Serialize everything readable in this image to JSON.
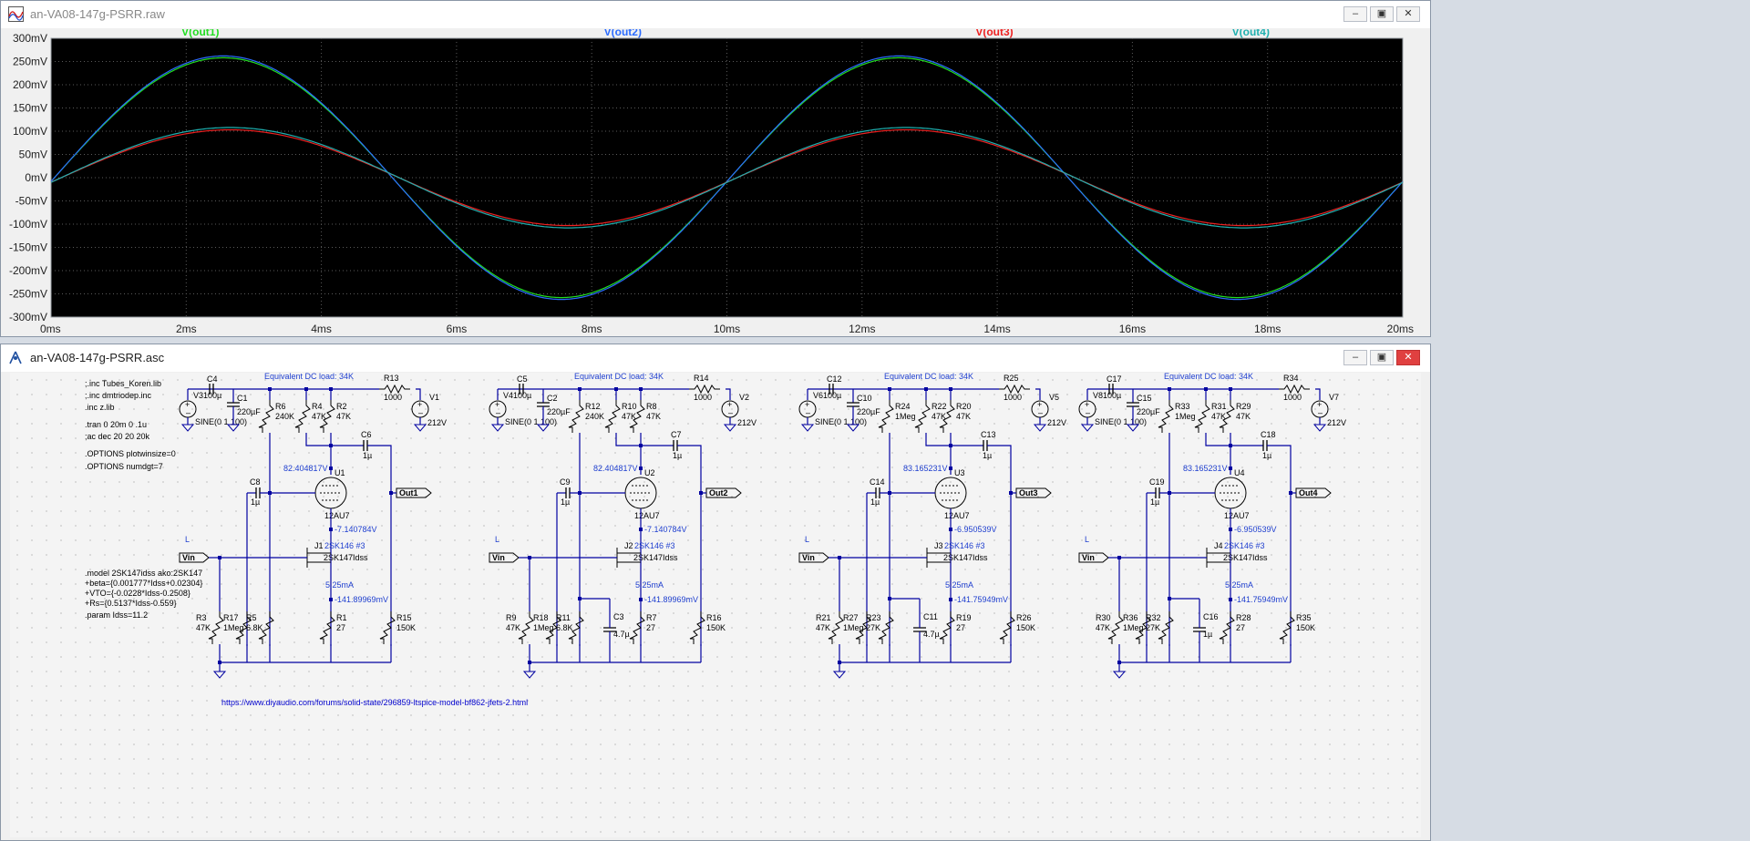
{
  "waveform_window": {
    "title": "an-VA08-147g-PSRR.raw",
    "traces": [
      {
        "label": "V(out1)",
        "color": "#22dd22"
      },
      {
        "label": "V(out2)",
        "color": "#2b6cff"
      },
      {
        "label": "V(out3)",
        "color": "#ee2222"
      },
      {
        "label": "V(out4)",
        "color": "#20b0b0"
      }
    ],
    "y_ticks": [
      "300mV",
      "250mV",
      "200mV",
      "150mV",
      "100mV",
      "50mV",
      "0mV",
      "-50mV",
      "-100mV",
      "-150mV",
      "-200mV",
      "-250mV",
      "-300mV"
    ],
    "x_ticks": [
      "0ms",
      "2ms",
      "4ms",
      "6ms",
      "8ms",
      "10ms",
      "12ms",
      "14ms",
      "16ms",
      "18ms",
      "20ms"
    ]
  },
  "chart_data": {
    "type": "line",
    "xlabel": "",
    "ylabel": "",
    "xlim": [
      0,
      20
    ],
    "ylim": [
      -300,
      300
    ],
    "x_unit": "ms",
    "y_unit": "mV",
    "grid": true,
    "legend": "top",
    "series": [
      {
        "name": "V(out1)",
        "color": "#22dd22",
        "amplitude_mV": 258,
        "offset_mV": 0,
        "period_ms": 10,
        "phase_ms": 0.05
      },
      {
        "name": "V(out2)",
        "color": "#2b6cff",
        "amplitude_mV": 262,
        "offset_mV": 0,
        "period_ms": 10,
        "phase_ms": 0.05
      },
      {
        "name": "V(out3)",
        "color": "#ee2222",
        "amplitude_mV": 103,
        "offset_mV": 0,
        "period_ms": 10,
        "phase_ms": 0.15
      },
      {
        "name": "V(out4)",
        "color": "#20b0b0",
        "amplitude_mV": 108,
        "offset_mV": 0,
        "period_ms": 10,
        "phase_ms": 0.15
      }
    ]
  },
  "schematic_window": {
    "title": "an-VA08-147g-PSRR.asc",
    "directives": [
      ";.inc Tubes_Koren.lib",
      ";.inc dmtriodep.inc",
      ".inc z.lib",
      ".tran 0 20m 0 .1u",
      ";ac dec 20 20 20k",
      ".OPTIONS plotwinsize=0",
      ".OPTIONS numdgt=7"
    ],
    "model_lines": [
      ".model 2SK147idss ako:2SK147",
      "+beta={0.001777*Idss+0.02304}",
      "+VTO={-0.0228*Idss-0.2508}",
      "+Rs={0.5137*Idss-0.559}",
      ".param Idss=11.2"
    ],
    "url": "https://www.diyaudio.com/forums/solid-state/296859-ltspice-model-bf862-jfets-2.html",
    "cells": [
      {
        "header": "Equivalent DC load: 34K",
        "c_in": "C4",
        "c_in_val": "100µ",
        "vsrc": "V3",
        "vsrc_val": "SINE(0 1 100)",
        "c_bulk": "C1",
        "c_bulk_val": "220µF",
        "r_a": "R6",
        "r_a_val": "240K",
        "r_b": "R4",
        "r_b_val": "47K",
        "r_plate": "R2",
        "r_plate_val": "47K",
        "r_series": "R13",
        "r_series_val": "1000",
        "vdc": "V1",
        "vdc_val": "212V",
        "c_out": "C6",
        "c_out_val": "1µ",
        "vplate": "82.404817V",
        "tube": "U1",
        "tube_model": "12AU7",
        "c_grid": "C8",
        "c_grid_val": "1µ",
        "out_label": "Out1",
        "vgrid": "7.140784V",
        "jfet": "J1",
        "jfet_model": "2SK147Idss",
        "jfet_note": "2SK146 #3",
        "current": "5.25mA",
        "vsource": "141.89969mV",
        "r_bot1": "R3",
        "r_bot1_val": "47K",
        "r_bot2": "R17",
        "r_bot2_val": "1Meg",
        "r_bot3": "R5",
        "r_bot3_val": "6.8K",
        "r_cath": "R1",
        "r_cath_val": "27",
        "r_load": "R15",
        "r_load_val": "150K",
        "extra_c": "",
        "extra_c_val": "",
        "l_label": "L",
        "vin_label": "Vin"
      },
      {
        "header": "Equivalent DC load: 34K",
        "c_in": "C5",
        "c_in_val": "100µ",
        "vsrc": "V4",
        "vsrc_val": "SINE(0 1 100)",
        "c_bulk": "C2",
        "c_bulk_val": "220µF",
        "r_a": "R12",
        "r_a_val": "240K",
        "r_b": "R10",
        "r_b_val": "47K",
        "r_plate": "R8",
        "r_plate_val": "47K",
        "r_series": "R14",
        "r_series_val": "1000",
        "vdc": "V2",
        "vdc_val": "212V",
        "c_out": "C7",
        "c_out_val": "1µ",
        "vplate": "82.404817V",
        "tube": "U2",
        "tube_model": "12AU7",
        "c_grid": "C9",
        "c_grid_val": "1µ",
        "out_label": "Out2",
        "vgrid": "7.140784V",
        "jfet": "J2",
        "jfet_model": "2SK147Idss",
        "jfet_note": "2SK146 #3",
        "current": "5.25mA",
        "vsource": "141.89969mV",
        "r_bot1": "R9",
        "r_bot1_val": "47K",
        "r_bot2": "R18",
        "r_bot2_val": "1Meg",
        "r_bot3": "R11",
        "r_bot3_val": "6.8K",
        "r_cath": "R7",
        "r_cath_val": "27",
        "r_load": "R16",
        "r_load_val": "150K",
        "extra_c": "C3",
        "extra_c_val": "4.7µ",
        "l_label": "L",
        "vin_label": "Vin"
      },
      {
        "header": "Equivalent DC load: 34K",
        "c_in": "C12",
        "c_in_val": "100µ",
        "vsrc": "V6",
        "vsrc_val": "SINE(0 1 100)",
        "c_bulk": "C10",
        "c_bulk_val": "220µF",
        "r_a": "R24",
        "r_a_val": "1Meg",
        "r_b": "R22",
        "r_b_val": "47K",
        "r_plate": "R20",
        "r_plate_val": "47K",
        "r_series": "R25",
        "r_series_val": "1000",
        "vdc": "V5",
        "vdc_val": "212V",
        "c_out": "C13",
        "c_out_val": "1µ",
        "vplate": "83.165231V",
        "tube": "U3",
        "tube_model": "12AU7",
        "c_grid": "C14",
        "c_grid_val": "1µ",
        "out_label": "Out3",
        "vgrid": "6.950539V",
        "jfet": "J3",
        "jfet_model": "2SK147Idss",
        "jfet_note": "2SK146 #3",
        "current": "5.25mA",
        "vsource": "141.75949mV",
        "r_bot1": "R21",
        "r_bot1_val": "47K",
        "r_bot2": "R27",
        "r_bot2_val": "1Meg",
        "r_bot3": "R23",
        "r_bot3_val": "27K",
        "r_cath": "R19",
        "r_cath_val": "27",
        "r_load": "R26",
        "r_load_val": "150K",
        "extra_c": "C11",
        "extra_c_val": "4.7µ",
        "l_label": "L",
        "vin_label": "Vin"
      },
      {
        "header": "Equivalent DC load: 34K",
        "c_in": "C17",
        "c_in_val": "100µ",
        "vsrc": "V8",
        "vsrc_val": "SINE(0 1 100)",
        "c_bulk": "C15",
        "c_bulk_val": "220µF",
        "r_a": "R33",
        "r_a_val": "1Meg",
        "r_b": "R31",
        "r_b_val": "47K",
        "r_plate": "R29",
        "r_plate_val": "47K",
        "r_series": "R34",
        "r_series_val": "1000",
        "vdc": "V7",
        "vdc_val": "212V",
        "c_out": "C18",
        "c_out_val": "1µ",
        "vplate": "83.165231V",
        "tube": "U4",
        "tube_model": "12AU7",
        "c_grid": "C19",
        "c_grid_val": "1µ",
        "out_label": "Out4",
        "vgrid": "6.950539V",
        "jfet": "J4",
        "jfet_model": "2SK147Idss",
        "jfet_note": "2SK146 #3",
        "current": "5.25mA",
        "vsource": "141.75949mV",
        "r_bot1": "R30",
        "r_bot1_val": "47K",
        "r_bot2": "R36",
        "r_bot2_val": "1Meg",
        "r_bot3": "R32",
        "r_bot3_val": "27K",
        "r_cath": "R28",
        "r_cath_val": "27",
        "r_load": "R35",
        "r_load_val": "150K",
        "extra_c": "C16",
        "extra_c_val": "1µ",
        "l_label": "L",
        "vin_label": "Vin"
      }
    ]
  }
}
